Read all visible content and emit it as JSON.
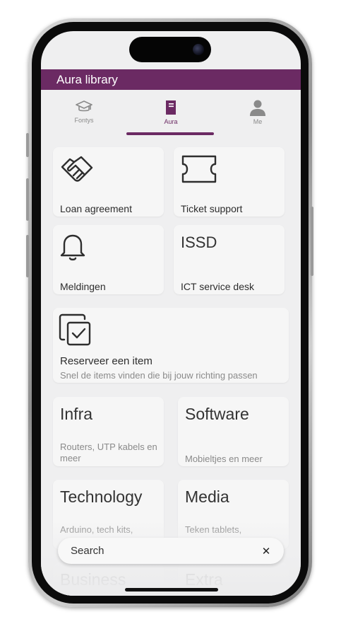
{
  "appbar": {
    "title": "Aura library"
  },
  "tabs": [
    {
      "label": "Fontys",
      "icon": "graduation-cap-icon"
    },
    {
      "label": "Aura",
      "icon": "book-icon"
    },
    {
      "label": "Me",
      "icon": "person-icon"
    }
  ],
  "cards": {
    "loan": {
      "label": "Loan agreement",
      "icon": "handshake-icon"
    },
    "ticket": {
      "label": "Ticket support",
      "icon": "ticket-icon"
    },
    "meldingen": {
      "label": "Meldingen",
      "icon": "bell-icon"
    },
    "issd": {
      "title": "ISSD",
      "label": "ICT service desk"
    },
    "reserve": {
      "label": "Reserveer een item",
      "sub": "Snel de items vinden die bij jouw richting passen",
      "icon": "checkbox-stack-icon"
    },
    "infra": {
      "title": "Infra",
      "sub": "Routers, UTP kabels en meer"
    },
    "software": {
      "title": "Software",
      "sub": "Mobieltjes en meer"
    },
    "technology": {
      "title": "Technology",
      "sub": "Arduino, tech kits,"
    },
    "media": {
      "title": "Media",
      "sub": "Teken tablets,"
    },
    "business": {
      "title": "Business"
    },
    "extra": {
      "title": "Extra"
    }
  },
  "search": {
    "placeholder": "Search",
    "value": ""
  },
  "colors": {
    "accent": "#6b2a63",
    "background": "#efeff0",
    "card": "#f6f6f6"
  }
}
